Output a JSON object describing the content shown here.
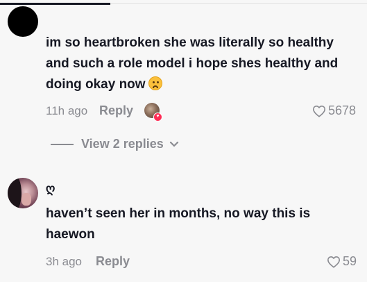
{
  "comments": [
    {
      "text_lines": [
        "im so heartbroken she was literally so healthy",
        "and such a role model i hope shes healthy and",
        "doing okay now"
      ],
      "emoji": "worried-face-emoji",
      "time": "11h ago",
      "reply_label": "Reply",
      "likes": "5678",
      "view_replies": "View 2 replies"
    },
    {
      "username": "ღ",
      "text_lines": [
        "haven’t seen her in months, no way this is",
        "haewon"
      ],
      "time": "3h ago",
      "reply_label": "Reply",
      "likes": "59"
    }
  ],
  "colors": {
    "background": "#f7f7f7",
    "text": "#161823",
    "muted": "#8a8b91",
    "creator_like_badge": "#fe2c55"
  }
}
